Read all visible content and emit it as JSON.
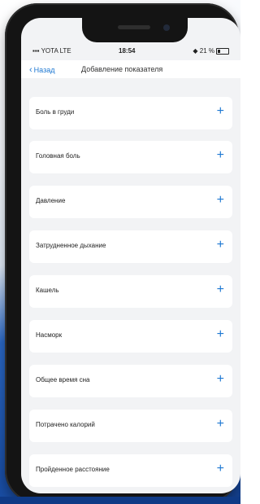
{
  "status_bar": {
    "carrier": "YOTA LTE",
    "time": "18:54",
    "battery": "21 %"
  },
  "nav": {
    "back_label": "Назад",
    "title": "Добавление показателя"
  },
  "items": [
    {
      "label": "Боль в груди"
    },
    {
      "label": "Головная боль"
    },
    {
      "label": "Давление"
    },
    {
      "label": "Затрудненное дыхание"
    },
    {
      "label": "Кашель"
    },
    {
      "label": "Насморк"
    },
    {
      "label": "Общее время сна"
    },
    {
      "label": "Потрачено калорий"
    },
    {
      "label": "Пройденное расстояние"
    }
  ],
  "plus_symbol": "+",
  "colors": {
    "accent": "#1e78d2",
    "background_blue": "#1a4fa6",
    "screen_bg": "#f2f3f5"
  }
}
